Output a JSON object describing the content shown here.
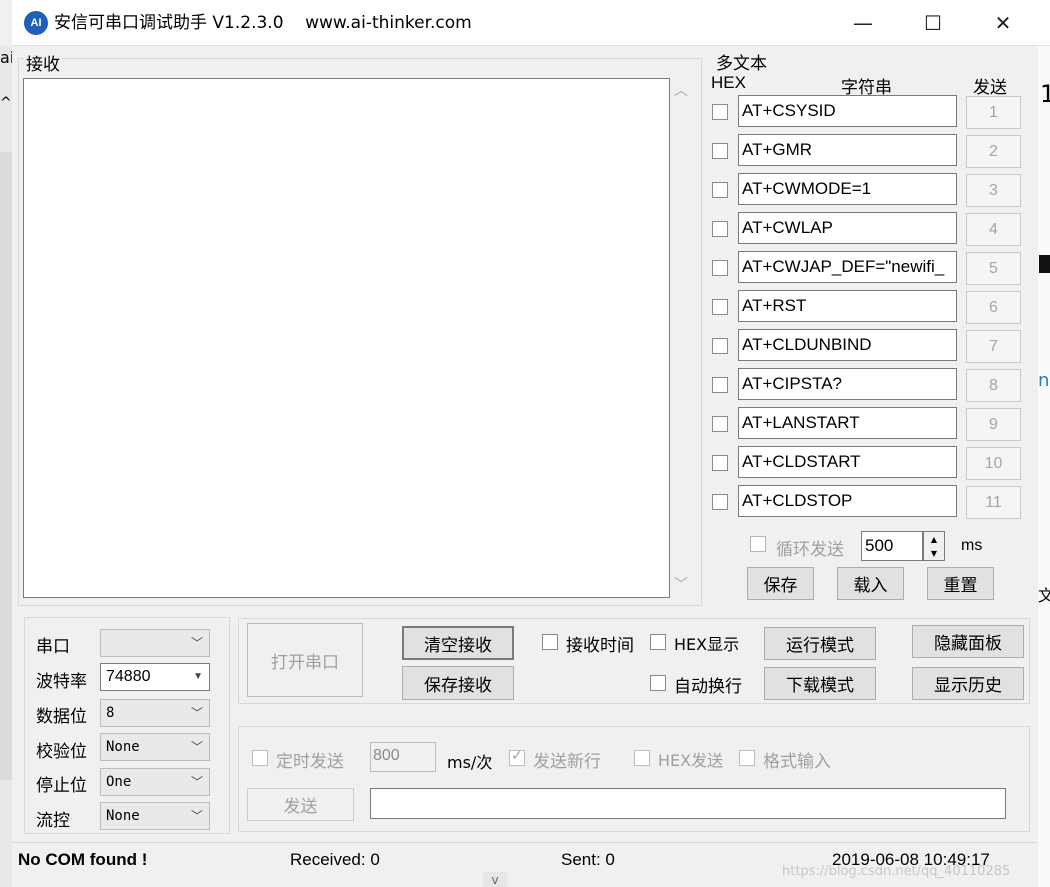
{
  "window": {
    "title": "安信可串口调试助手 V1.2.3.0    www.ai-thinker.com",
    "icon_text": "AI",
    "minimize": "—",
    "maximize": "☐",
    "close": "✕"
  },
  "background_app": {
    "left_a": "ai",
    "left_b": "^",
    "right_1": "1",
    "right_n": "n",
    "right_wen": "文"
  },
  "receive": {
    "label": "接收",
    "content": ""
  },
  "multitext": {
    "label": "多文本",
    "header_hex": "HEX",
    "header_string": "字符串",
    "header_send": "发送",
    "rows": [
      {
        "hex": false,
        "text": "AT+CSYSID",
        "button": "1"
      },
      {
        "hex": false,
        "text": "AT+GMR",
        "button": "2"
      },
      {
        "hex": false,
        "text": "AT+CWMODE=1",
        "button": "3"
      },
      {
        "hex": false,
        "text": "AT+CWLAP",
        "button": "4"
      },
      {
        "hex": false,
        "text": "AT+CWJAP_DEF=\"newifi_",
        "button": "5"
      },
      {
        "hex": false,
        "text": "AT+RST",
        "button": "6"
      },
      {
        "hex": false,
        "text": "AT+CLDUNBIND",
        "button": "7"
      },
      {
        "hex": false,
        "text": "AT+CIPSTA?",
        "button": "8"
      },
      {
        "hex": false,
        "text": "AT+LANSTART",
        "button": "9"
      },
      {
        "hex": false,
        "text": "AT+CLDSTART",
        "button": "10"
      },
      {
        "hex": false,
        "text": "AT+CLDSTOP",
        "button": "11"
      }
    ],
    "loop_send_label": "循环发送",
    "loop_interval": "500",
    "loop_unit": "ms",
    "save": "保存",
    "load": "载入",
    "reset": "重置"
  },
  "serial": {
    "port_label": "串口",
    "port_value": "",
    "baud_label": "波特率",
    "baud_value": "74880",
    "databits_label": "数据位",
    "databits_value": "8",
    "parity_label": "校验位",
    "parity_value": "None",
    "stopbits_label": "停止位",
    "stopbits_value": "One",
    "flow_label": "流控",
    "flow_value": "None"
  },
  "controls": {
    "open_port": "打开串口",
    "clear_receive": "清空接收",
    "save_receive": "保存接收",
    "receive_time": "接收时间",
    "hex_display": "HEX显示",
    "auto_newline": "自动换行",
    "run_mode": "运行模式",
    "download_mode": "下载模式",
    "hide_panel": "隐藏面板",
    "show_history": "显示历史"
  },
  "send": {
    "timed_send": "定时发送",
    "interval": "800",
    "interval_unit": "ms/次",
    "send_newline": "发送新行",
    "hex_send": "HEX发送",
    "format_input": "格式输入",
    "send_button": "发送",
    "send_text": ""
  },
  "status": {
    "com": "No COM found !",
    "received": "Received: 0",
    "sent": "Sent: 0",
    "datetime": "2019-06-08 10:49:17",
    "watermark": "https://blog.csdn.net/qq_40110285"
  },
  "bottom_mark": "v"
}
